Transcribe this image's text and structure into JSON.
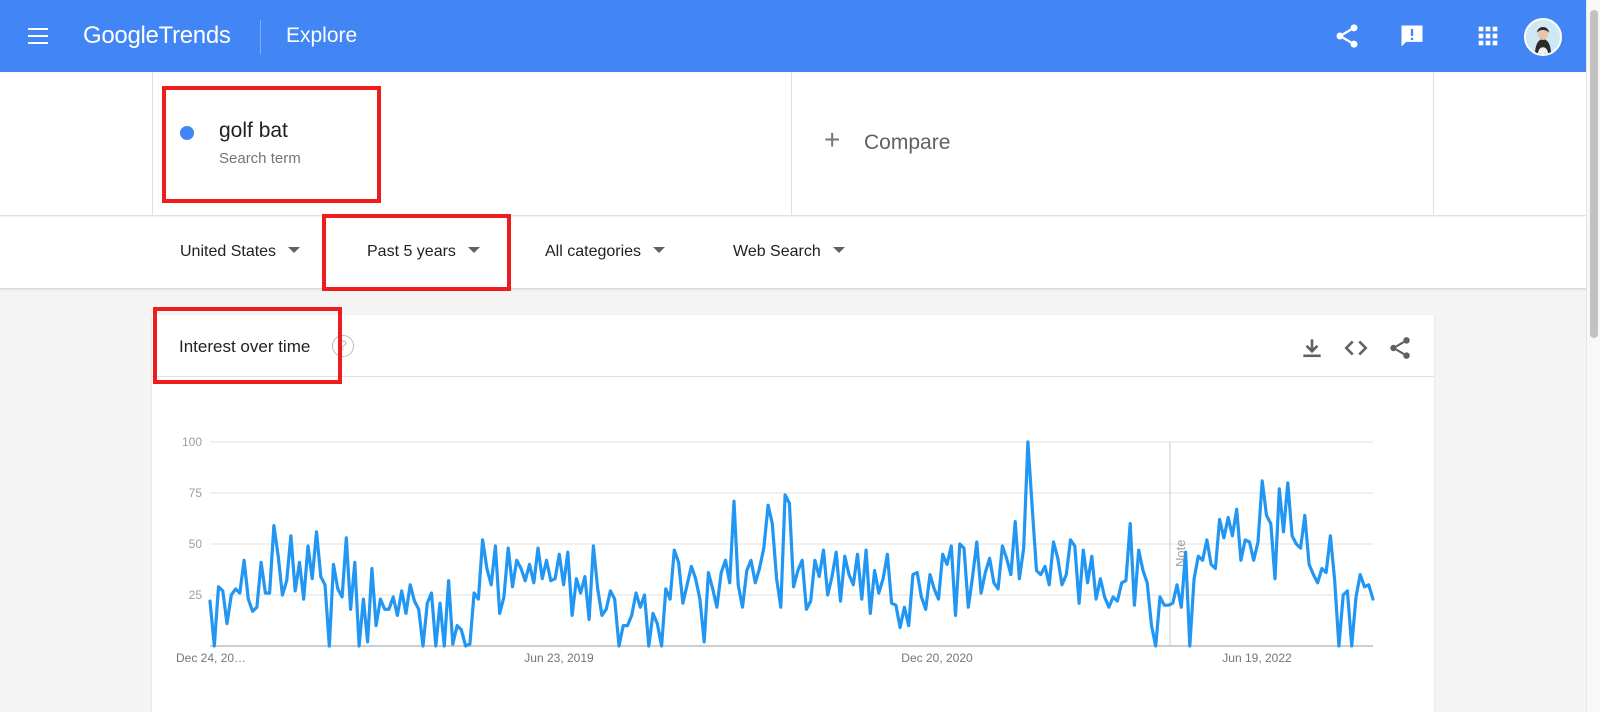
{
  "header": {
    "logo_google": "Google",
    "logo_trends": "Trends",
    "page_title": "Explore",
    "icons": [
      "menu-icon",
      "share-icon",
      "feedback-icon",
      "apps-grid-icon",
      "account-avatar"
    ],
    "colors": {
      "bar": "#4285f4"
    }
  },
  "search": {
    "term": "golf bat",
    "term_type": "Search term",
    "term_color": "#4285f4",
    "compare_label": "Compare"
  },
  "filters": {
    "region": "United States",
    "time_range": "Past 5 years",
    "category": "All categories",
    "search_type": "Web Search"
  },
  "interest_card": {
    "title": "Interest over time",
    "help_symbol": "?",
    "icons": [
      "download-icon",
      "embed-icon",
      "share-icon"
    ],
    "note_label": "Note"
  },
  "highlight_color": "#ee1c1c",
  "chart_data": {
    "type": "line",
    "title": "Interest over time",
    "series": [
      {
        "name": "golf bat",
        "color": "#2196f3",
        "values": [
          22,
          0,
          29,
          27,
          11,
          25,
          28,
          26,
          42,
          23,
          17,
          19,
          41,
          26,
          26,
          59,
          44,
          25,
          32,
          54,
          27,
          41,
          23,
          49,
          33,
          56,
          34,
          30,
          0,
          40,
          28,
          24,
          53,
          18,
          41,
          0,
          23,
          2,
          38,
          10,
          23,
          18,
          18,
          24,
          15,
          27,
          16,
          30,
          22,
          18,
          0,
          21,
          26,
          0,
          21,
          0,
          32,
          1,
          10,
          8,
          0,
          1,
          26,
          23,
          52,
          38,
          30,
          49,
          16,
          24,
          48,
          29,
          42,
          38,
          32,
          40,
          31,
          48,
          33,
          42,
          32,
          33,
          45,
          30,
          46,
          15,
          33,
          26,
          34,
          13,
          49,
          28,
          15,
          18,
          27,
          23,
          0,
          10,
          10,
          15,
          26,
          19,
          25,
          0,
          16,
          11,
          0,
          28,
          23,
          47,
          41,
          21,
          30,
          39,
          33,
          23,
          2,
          36,
          28,
          19,
          36,
          42,
          31,
          71,
          30,
          19,
          37,
          42,
          31,
          38,
          48,
          69,
          60,
          33,
          19,
          74,
          70,
          29,
          37,
          42,
          18,
          22,
          42,
          34,
          47,
          25,
          34,
          46,
          22,
          44,
          35,
          30,
          45,
          23,
          47,
          16,
          37,
          26,
          33,
          45,
          21,
          20,
          9,
          19,
          10,
          35,
          36,
          24,
          18,
          35,
          28,
          23,
          45,
          40,
          49,
          15,
          50,
          48,
          19,
          34,
          51,
          26,
          36,
          43,
          31,
          28,
          49,
          43,
          35,
          61,
          33,
          48,
          100,
          68,
          37,
          35,
          39,
          30,
          51,
          43,
          30,
          35,
          52,
          49,
          21,
          47,
          31,
          44,
          23,
          33,
          24,
          19,
          24,
          22,
          31,
          32,
          60,
          20,
          47,
          37,
          31,
          10,
          0,
          24,
          20,
          20,
          21,
          30,
          19,
          46,
          0,
          33,
          44,
          42,
          52,
          40,
          38,
          62,
          53,
          63,
          54,
          67,
          42,
          52,
          51,
          42,
          51,
          81,
          64,
          60,
          33,
          77,
          56,
          80,
          54,
          50,
          48,
          64,
          40,
          35,
          31,
          38,
          36,
          54,
          32,
          0,
          25,
          27,
          0,
          24,
          35,
          29,
          30,
          23
        ]
      }
    ],
    "x_tick_labels": [
      "Dec 24, 20…",
      "Jun 23, 2019",
      "Dec 20, 2020",
      "Jun 19, 2022"
    ],
    "y_ticks": [
      100,
      75,
      50,
      25
    ],
    "ylim": [
      0,
      100
    ],
    "annotation": "Note",
    "grid": true
  }
}
